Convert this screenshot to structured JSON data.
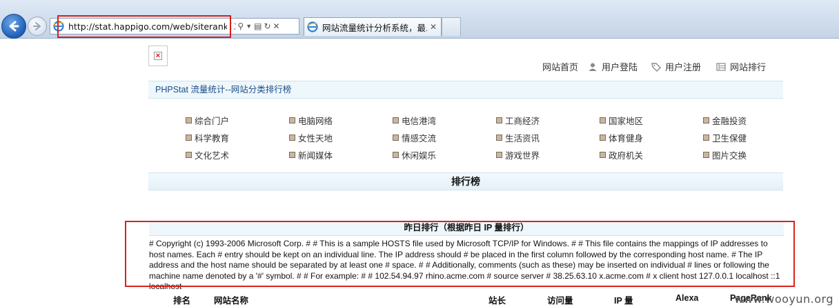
{
  "browser": {
    "url": "http://stat.happigo.com/web/siterank.ph",
    "tab_title": "网站流量统计分析系统，最..."
  },
  "topnav": [
    {
      "label": "网站首页",
      "icon": "none"
    },
    {
      "label": "用户登陆",
      "icon": "user-icon"
    },
    {
      "label": "用户注册",
      "icon": "tag-icon"
    },
    {
      "label": "网站排行",
      "icon": "list-icon"
    }
  ],
  "header": {
    "title": "PHPStat 流量统计--网站分类排行榜"
  },
  "categories": [
    [
      "综合门户",
      "电脑网络",
      "电信港湾",
      "工商经济",
      "国家地区",
      "金融投资"
    ],
    [
      "科学教育",
      "女性天地",
      "情感交流",
      "生活资讯",
      "体育健身",
      "卫生保健"
    ],
    [
      "文化艺术",
      "新闻媒体",
      "休闲娱乐",
      "游戏世界",
      "政府机关",
      "图片交换"
    ]
  ],
  "ranking": {
    "title": "排行榜",
    "yesterday_title": "昨日排行（根据昨日 IP 量排行）",
    "hosts_text": "# Copyright (c) 1993-2006 Microsoft Corp. # # This is a sample HOSTS file used by Microsoft TCP/IP for Windows. # # This file contains the mappings of IP addresses to host names. Each # entry should be kept on an individual line. The IP address should # be placed in the first column followed by the corresponding host name. # The IP address and the host name should be separated by at least one # space. # # Additionally, comments (such as these) may be inserted on individual # lines or following the machine name denoted by a '#' symbol. # # For example: # # 102.54.94.97 rhino.acme.com # source server # 38.25.63.10 x.acme.com # x client host 127.0.0.1 localhost ::1 localhost",
    "columns": [
      "排名",
      "网站名称",
      "站长",
      "访问量",
      "IP 量",
      "Alexa",
      "PageRank"
    ]
  },
  "watermark": "www.wooyun.org",
  "colors": {
    "highlight_red": "#d9201d",
    "bar_bg": "#eef7fb",
    "title_blue": "#1d4d8a"
  }
}
